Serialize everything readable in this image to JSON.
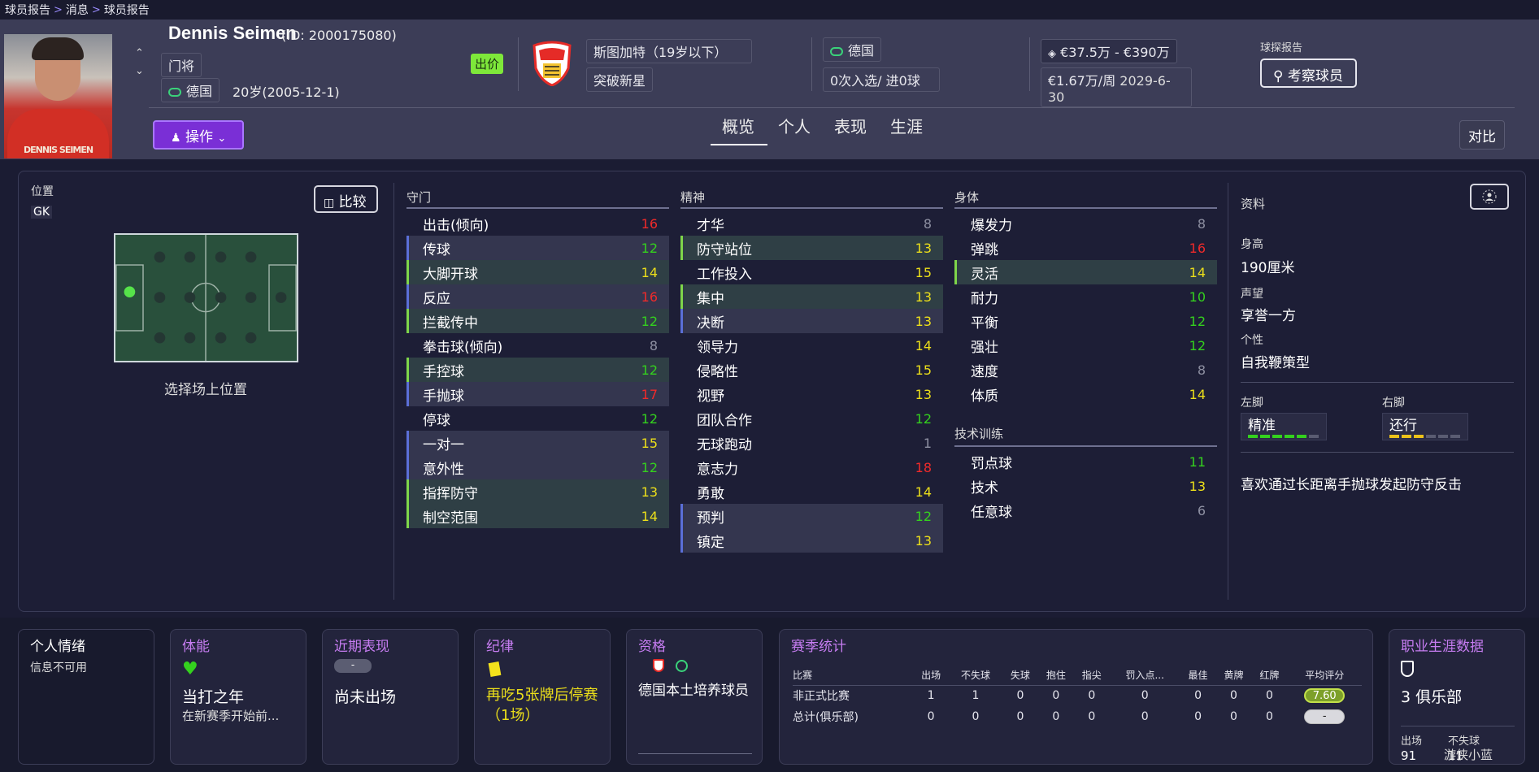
{
  "breadcrumb": {
    "items": [
      "球员报告",
      "消息",
      "球员报告"
    ]
  },
  "player": {
    "name": "Dennis Seimen",
    "id_text": "(ID: 2000175080)",
    "position": "门将",
    "nationality": "德国",
    "age_text": "20岁(2005-12-1)",
    "bid_label": "出价",
    "shirt_text": "DENNIS SEIMEN"
  },
  "club": {
    "team": "斯图加特（19岁以下）",
    "status": "突破新星"
  },
  "nation": {
    "name": "德国",
    "caps": "0次入选/ 进0球"
  },
  "contract": {
    "value": "€37.5万 - €390万",
    "wage": "€1.67万/周",
    "expiry": "2029-6-30"
  },
  "scout": {
    "label": "球探报告",
    "button": "考察球员"
  },
  "actions": {
    "label": "操作"
  },
  "tabs": [
    "概览",
    "个人",
    "表现",
    "生涯"
  ],
  "compare_top": "对比",
  "position_panel": {
    "label": "位置",
    "value": "GK",
    "compare": "比较",
    "pick_hint": "选择场上位置"
  },
  "columns": {
    "goalkeeping": {
      "title": "守门",
      "rows": [
        {
          "name": "出击(倾向)",
          "value": "16",
          "color": "red",
          "bg": "",
          "mark": ""
        },
        {
          "name": "传球",
          "value": "12",
          "color": "green",
          "bg": "hl",
          "mark": "blue"
        },
        {
          "name": "大脚开球",
          "value": "14",
          "color": "yellow",
          "bg": "hl2",
          "mark": "green"
        },
        {
          "name": "反应",
          "value": "16",
          "color": "red",
          "bg": "hl",
          "mark": "blue"
        },
        {
          "name": "拦截传中",
          "value": "12",
          "color": "green",
          "bg": "hl2",
          "mark": "green"
        },
        {
          "name": "拳击球(倾向)",
          "value": "8",
          "color": "grey",
          "bg": "",
          "mark": ""
        },
        {
          "name": "手控球",
          "value": "12",
          "color": "green",
          "bg": "hl2",
          "mark": "green"
        },
        {
          "name": "手抛球",
          "value": "17",
          "color": "red",
          "bg": "hl",
          "mark": "blue"
        },
        {
          "name": "停球",
          "value": "12",
          "color": "green",
          "bg": "",
          "mark": ""
        },
        {
          "name": "一对一",
          "value": "15",
          "color": "yellow",
          "bg": "hl",
          "mark": "blue"
        },
        {
          "name": "意外性",
          "value": "12",
          "color": "green",
          "bg": "hl",
          "mark": "blue"
        },
        {
          "name": "指挥防守",
          "value": "13",
          "color": "yellow",
          "bg": "hl2",
          "mark": "green"
        },
        {
          "name": "制空范围",
          "value": "14",
          "color": "yellow",
          "bg": "hl2",
          "mark": "green"
        }
      ]
    },
    "mental": {
      "title": "精神",
      "rows": [
        {
          "name": "才华",
          "value": "8",
          "color": "grey",
          "bg": "",
          "mark": ""
        },
        {
          "name": "防守站位",
          "value": "13",
          "color": "yellow",
          "bg": "hl2",
          "mark": "green"
        },
        {
          "name": "工作投入",
          "value": "15",
          "color": "yellow",
          "bg": "",
          "mark": ""
        },
        {
          "name": "集中",
          "value": "13",
          "color": "yellow",
          "bg": "hl2",
          "mark": "green"
        },
        {
          "name": "决断",
          "value": "13",
          "color": "yellow",
          "bg": "hl",
          "mark": "blue"
        },
        {
          "name": "领导力",
          "value": "14",
          "color": "yellow",
          "bg": "",
          "mark": ""
        },
        {
          "name": "侵略性",
          "value": "15",
          "color": "yellow",
          "bg": "",
          "mark": ""
        },
        {
          "name": "视野",
          "value": "13",
          "color": "yellow",
          "bg": "",
          "mark": ""
        },
        {
          "name": "团队合作",
          "value": "12",
          "color": "green",
          "bg": "",
          "mark": ""
        },
        {
          "name": "无球跑动",
          "value": "1",
          "color": "grey",
          "bg": "",
          "mark": ""
        },
        {
          "name": "意志力",
          "value": "18",
          "color": "red",
          "bg": "",
          "mark": ""
        },
        {
          "name": "勇敢",
          "value": "14",
          "color": "yellow",
          "bg": "",
          "mark": ""
        },
        {
          "name": "预判",
          "value": "12",
          "color": "green",
          "bg": "hl",
          "mark": "blue"
        },
        {
          "name": "镇定",
          "value": "13",
          "color": "yellow",
          "bg": "hl",
          "mark": "blue"
        }
      ]
    },
    "physical": {
      "title": "身体",
      "rows": [
        {
          "name": "爆发力",
          "value": "8",
          "color": "grey",
          "bg": "",
          "mark": ""
        },
        {
          "name": "弹跳",
          "value": "16",
          "color": "red",
          "bg": "",
          "mark": ""
        },
        {
          "name": "灵活",
          "value": "14",
          "color": "yellow",
          "bg": "hl2",
          "mark": "green"
        },
        {
          "name": "耐力",
          "value": "10",
          "color": "green",
          "bg": "",
          "mark": ""
        },
        {
          "name": "平衡",
          "value": "12",
          "color": "green",
          "bg": "",
          "mark": ""
        },
        {
          "name": "强壮",
          "value": "12",
          "color": "green",
          "bg": "",
          "mark": ""
        },
        {
          "name": "速度",
          "value": "8",
          "color": "grey",
          "bg": "",
          "mark": ""
        },
        {
          "name": "体质",
          "value": "14",
          "color": "yellow",
          "bg": "",
          "mark": ""
        }
      ]
    },
    "technical": {
      "title": "技术训练",
      "rows": [
        {
          "name": "罚点球",
          "value": "11",
          "color": "green",
          "bg": "",
          "mark": ""
        },
        {
          "name": "技术",
          "value": "13",
          "color": "yellow",
          "bg": "",
          "mark": ""
        },
        {
          "name": "任意球",
          "value": "6",
          "color": "grey",
          "bg": "",
          "mark": ""
        }
      ]
    }
  },
  "info": {
    "title": "资料",
    "height_label": "身高",
    "height": "190厘米",
    "reputation_label": "声望",
    "reputation": "享誉一方",
    "personality_label": "个性",
    "personality": "自我鞭策型",
    "left_foot_label": "左脚",
    "left_foot": "精准",
    "left_foot_level": 5,
    "right_foot_label": "右脚",
    "right_foot": "还行",
    "right_foot_level": 3,
    "foot_max": 6,
    "trait": "喜欢通过长距离手抛球发起防守反击"
  },
  "cards": {
    "mood": {
      "title": "个人情绪",
      "text": "信息不可用"
    },
    "fitness": {
      "title": "体能",
      "value": "当打之年",
      "sub": "在新赛季开始前..."
    },
    "form": {
      "title": "近期表现",
      "badge": "-",
      "value": "尚未出场"
    },
    "discipline": {
      "title": "纪律",
      "value": "再吃5张牌后停赛（1场）"
    },
    "eligibility": {
      "title": "资格",
      "value": "德国本土培养球员"
    },
    "season": {
      "title": "赛季统计",
      "headers": [
        "比赛",
        "出场",
        "不失球",
        "失球",
        "抱住",
        "指尖",
        "罚入点...",
        "最佳",
        "黄牌",
        "红牌",
        "平均评分"
      ],
      "rows": [
        {
          "label": "非正式比赛",
          "values": [
            "1",
            "1",
            "0",
            "0",
            "0",
            "0",
            "0",
            "0",
            "0"
          ],
          "rating": "7.60"
        },
        {
          "label": "总计(俱乐部)",
          "values": [
            "0",
            "0",
            "0",
            "0",
            "0",
            "0",
            "0",
            "0",
            "0"
          ],
          "rating": "-"
        }
      ]
    },
    "career": {
      "title": "职业生涯数据",
      "value": "3 俱乐部",
      "apps_label": "出场",
      "apps": "91",
      "cs_label": "不失球",
      "cs": "11"
    }
  },
  "watermark": "游侠小蓝",
  "colors": {
    "accent": "#7a2fd6",
    "red": "#f02a2a",
    "green": "#34d11e",
    "yellow": "#ecdf1a",
    "highlight_blue": "#5b6fd8",
    "highlight_green": "#7fd64a"
  }
}
